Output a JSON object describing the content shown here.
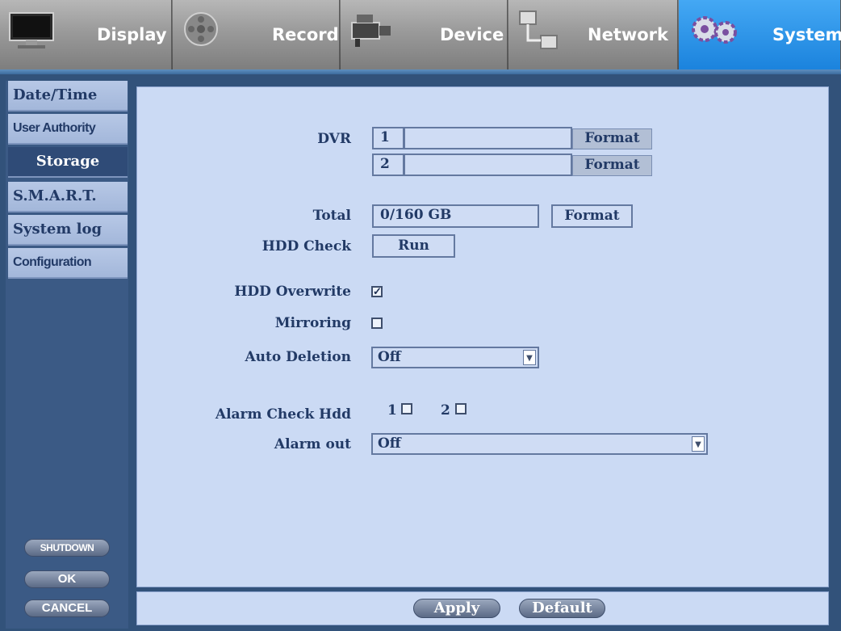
{
  "tabs": [
    {
      "label": "Display",
      "icon": "monitor-icon"
    },
    {
      "label": "Record",
      "icon": "film-reel-icon"
    },
    {
      "label": "Device",
      "icon": "camcorder-icon"
    },
    {
      "label": "Network",
      "icon": "network-icon"
    },
    {
      "label": "System",
      "icon": "gears-icon",
      "active": true
    }
  ],
  "sidebar": {
    "items": [
      {
        "label": "Date/Time"
      },
      {
        "label": "User Authority"
      },
      {
        "label": "Storage",
        "active": true
      },
      {
        "label": "S.M.A.R.T."
      },
      {
        "label": "System log"
      },
      {
        "label": "Configuration"
      }
    ],
    "shutdown_label": "SHUTDOWN",
    "ok_label": "OK",
    "cancel_label": "CANCEL"
  },
  "storage": {
    "dvr_label": "DVR",
    "dvr_rows": [
      {
        "num": "1",
        "value": "",
        "format_label": "Format"
      },
      {
        "num": "2",
        "value": "",
        "format_label": "Format"
      }
    ],
    "total_label": "Total",
    "total_value": "0/160 GB",
    "total_format_label": "Format",
    "hdd_check_label": "HDD Check",
    "run_label": "Run",
    "hdd_overwrite_label": "HDD Overwrite",
    "hdd_overwrite_checked": true,
    "mirroring_label": "Mirroring",
    "mirroring_checked": false,
    "auto_deletion_label": "Auto Deletion",
    "auto_deletion_value": "Off",
    "alarm_check_hdd_label": "Alarm Check Hdd",
    "alarm_check_hdd_1": "1",
    "alarm_check_hdd_2": "2",
    "alarm_out_label": "Alarm out",
    "alarm_out_value": "Off"
  },
  "footer": {
    "apply_label": "Apply",
    "default_label": "Default"
  },
  "colors": {
    "active_tab": "#1b83dd",
    "panel": "#cbdaf4",
    "frame": "#32527a",
    "text": "#223a66"
  }
}
